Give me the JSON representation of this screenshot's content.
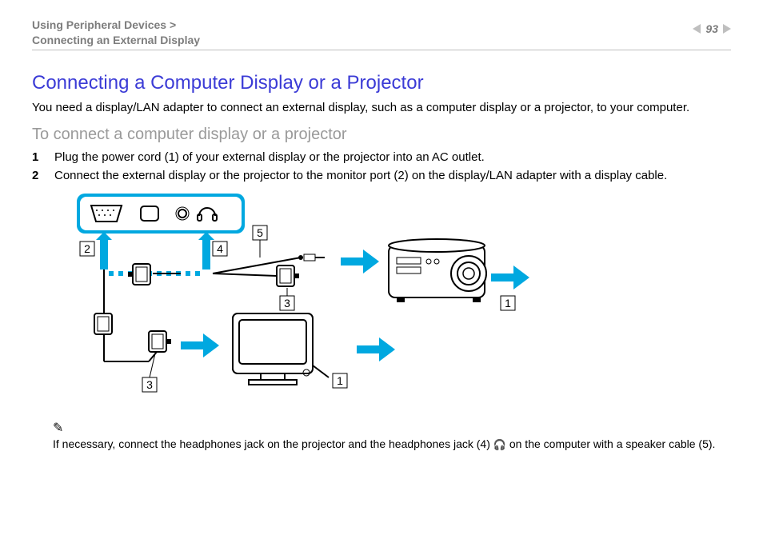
{
  "header": {
    "breadcrumb_line1": "Using Peripheral Devices >",
    "breadcrumb_line2": "Connecting an External Display",
    "page_number": "93"
  },
  "section": {
    "title": "Connecting a Computer Display or a Projector",
    "intro": "You need a display/LAN adapter to connect an external display, such as a computer display or a projector, to your computer.",
    "subtitle": "To connect a computer display or a projector",
    "steps": [
      {
        "n": "1",
        "text": "Plug the power cord (1) of your external display or the projector into an AC outlet."
      },
      {
        "n": "2",
        "text": "Connect the external display or the projector to the monitor port (2) on the display/LAN adapter with a display cable."
      }
    ],
    "note_prefix": "If necessary, connect the headphones jack on the projector and the headphones jack (4) ",
    "note_suffix": " on the computer with a speaker cable (5).",
    "note_icon": "✎"
  },
  "diagram": {
    "callouts": {
      "c1": "1",
      "c2": "2",
      "c3": "3",
      "c4": "4",
      "c5": "5"
    }
  }
}
